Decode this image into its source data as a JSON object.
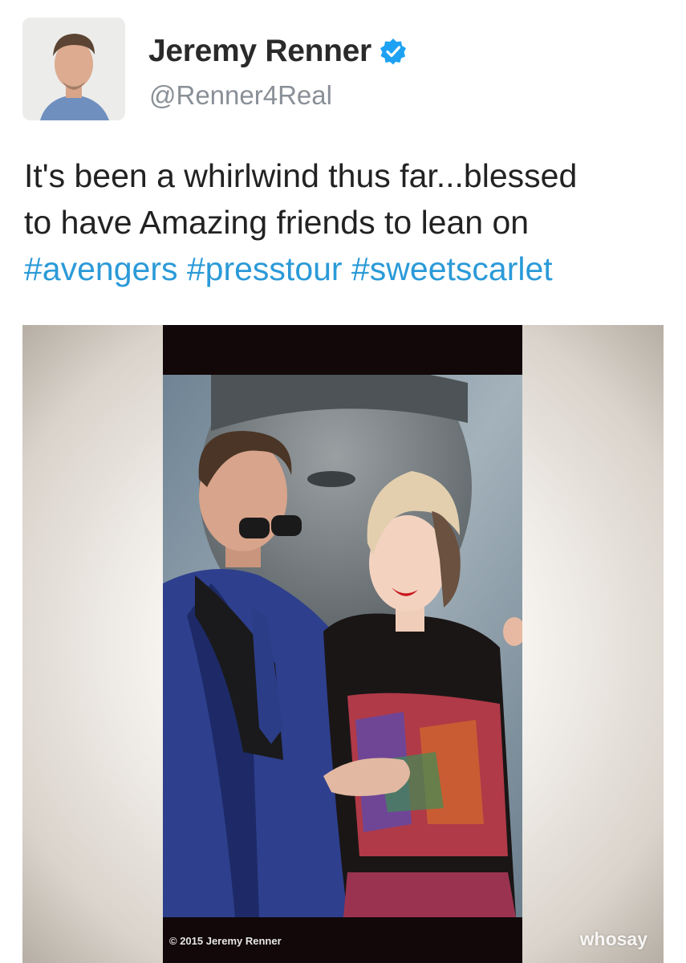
{
  "author": {
    "display_name": "Jeremy Renner",
    "handle": "@Renner4Real",
    "verified": true
  },
  "tweet": {
    "text_line1": "It's been a whirlwind thus far...blessed",
    "text_line2": "to have Amazing friends to lean on",
    "hashtags": [
      "#avengers",
      "#presstour",
      "#sweetscarlet"
    ]
  },
  "media": {
    "copyright": "© 2015 Jeremy Renner",
    "watermark": "whosay"
  },
  "colors": {
    "hashtag": "#2b9ad8",
    "verified_badge": "#1da1f2",
    "name": "#2a2a2a",
    "handle": "#8a9097"
  }
}
